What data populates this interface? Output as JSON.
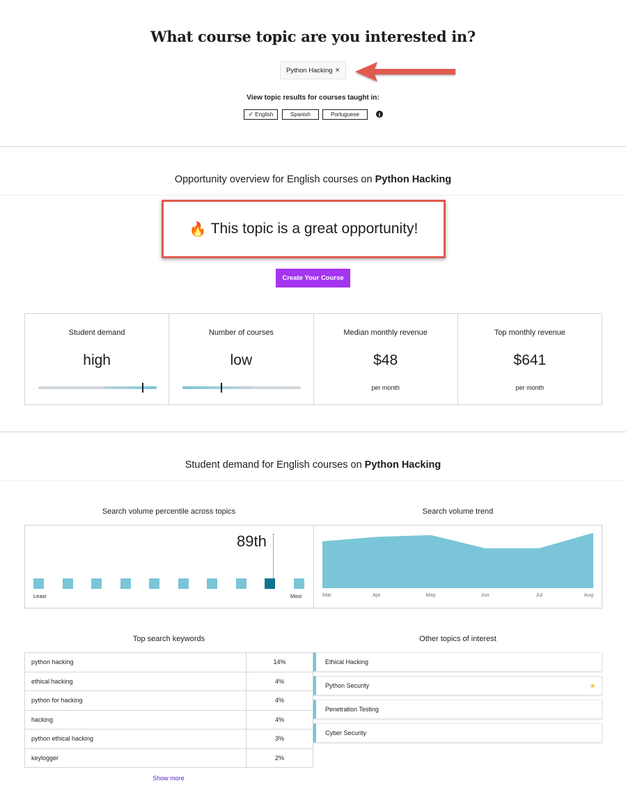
{
  "header": {
    "title": "What course topic are you interested in?",
    "topic_chip": "Python Hacking",
    "chip_remove": "×",
    "language_label": "View topic results for courses taught in:",
    "languages": [
      {
        "label": "English",
        "selected": true
      },
      {
        "label": "Spanish",
        "selected": false
      },
      {
        "label": "Portuguese",
        "selected": false
      }
    ],
    "info_icon": "i"
  },
  "overview": {
    "prefix": "Opportunity overview for English courses on ",
    "topic": "Python Hacking",
    "opportunity_text": "This topic is a great opportunity!",
    "flame_icon": "🔥",
    "create_button": "Create Your Course"
  },
  "stats": [
    {
      "label": "Student demand",
      "value": "high",
      "gauge_level": 0.88
    },
    {
      "label": "Number of courses",
      "value": "low",
      "gauge_level": 0.33
    },
    {
      "label": "Median monthly revenue",
      "value": "$48",
      "sub": "per month"
    },
    {
      "label": "Top monthly revenue",
      "value": "$641",
      "sub": "per month"
    }
  ],
  "demand": {
    "prefix": "Student demand for English courses on ",
    "topic": "Python Hacking"
  },
  "percentile": {
    "title": "Search volume percentile across topics",
    "value_label": "89th",
    "active_index": 8,
    "count": 10,
    "least_label": "Least",
    "most_label": "Most"
  },
  "trend": {
    "title": "Search volume trend",
    "months": [
      "Mar",
      "Apr",
      "May",
      "Jun",
      "Jul",
      "Aug"
    ],
    "values": [
      82,
      90,
      93,
      70,
      70,
      97
    ],
    "ylim": [
      0,
      100
    ],
    "fill_color": "#7ac5d8"
  },
  "keywords": {
    "title": "Top search keywords",
    "rows": [
      {
        "keyword": "python hacking",
        "pct": "14%"
      },
      {
        "keyword": "ethical hacking",
        "pct": "4%"
      },
      {
        "keyword": "python for hacking",
        "pct": "4%"
      },
      {
        "keyword": "hacking",
        "pct": "4%"
      },
      {
        "keyword": "python ethical hacking",
        "pct": "3%"
      },
      {
        "keyword": "keylogger",
        "pct": "2%"
      }
    ],
    "show_more": "Show more"
  },
  "other_topics": {
    "title": "Other topics of interest",
    "items": [
      {
        "label": "Ethical Hacking",
        "starred": false
      },
      {
        "label": "Python Security",
        "starred": true
      },
      {
        "label": "Penetration Testing",
        "starred": false
      },
      {
        "label": "Cyber Security",
        "starred": false
      }
    ],
    "star_icon": "★"
  },
  "colors": {
    "accent_purple": "#a435f0",
    "annotation_red": "#e05a4f",
    "teal_light": "#7ac5d8",
    "teal_dark": "#0d7590"
  }
}
